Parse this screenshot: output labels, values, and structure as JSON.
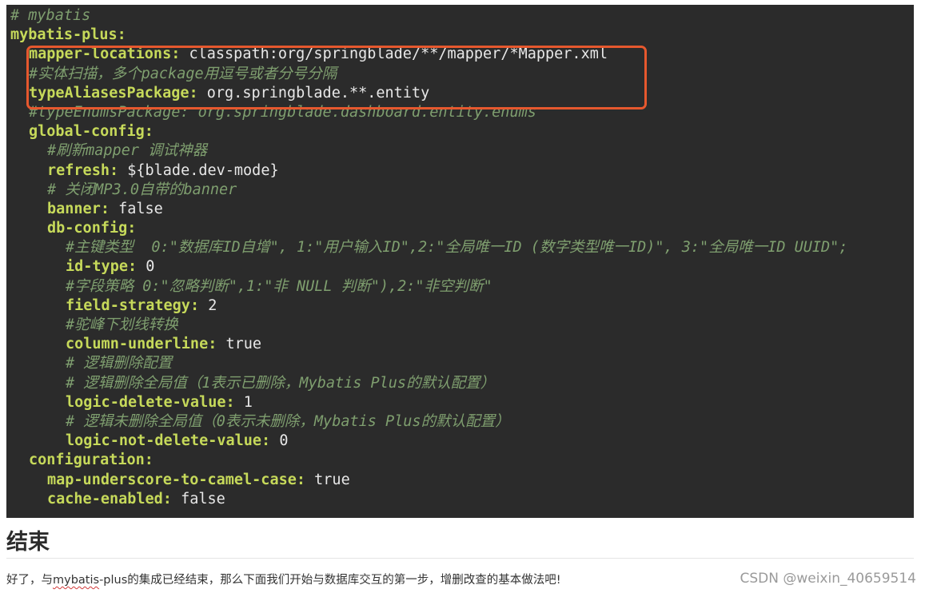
{
  "code": {
    "language": "yaml",
    "highlight_color": "#e6582e",
    "lines": [
      {
        "indent": 0,
        "type": "comment",
        "text": "# mybatis"
      },
      {
        "indent": 0,
        "type": "key",
        "key": "mybatis-plus",
        "value": ""
      },
      {
        "indent": 1,
        "type": "key",
        "key": "mapper-locations",
        "value": "classpath:org/springblade/**/mapper/*Mapper.xml"
      },
      {
        "indent": 1,
        "type": "comment",
        "text": "#实体扫描，多个package用逗号或者分号分隔"
      },
      {
        "indent": 1,
        "type": "key",
        "key": "typeAliasesPackage",
        "value": "org.springblade.**.entity"
      },
      {
        "indent": 1,
        "type": "comment",
        "text": "#typeEnumsPackage: org.springblade.dashboard.entity.enums"
      },
      {
        "indent": 1,
        "type": "key",
        "key": "global-config",
        "value": ""
      },
      {
        "indent": 2,
        "type": "comment",
        "text": "#刷新mapper 调试神器"
      },
      {
        "indent": 2,
        "type": "key",
        "key": "refresh",
        "value": "${blade.dev-mode}"
      },
      {
        "indent": 2,
        "type": "comment",
        "text": "# 关闭MP3.0自带的banner"
      },
      {
        "indent": 2,
        "type": "key",
        "key": "banner",
        "value": "false"
      },
      {
        "indent": 2,
        "type": "key",
        "key": "db-config",
        "value": ""
      },
      {
        "indent": 3,
        "type": "comment",
        "text": "#主键类型  0:\"数据库ID自增\", 1:\"用户输入ID\",2:\"全局唯一ID (数字类型唯一ID)\", 3:\"全局唯一ID UUID\";"
      },
      {
        "indent": 3,
        "type": "key",
        "key": "id-type",
        "value": "0"
      },
      {
        "indent": 3,
        "type": "comment",
        "text": "#字段策略 0:\"忽略判断\",1:\"非 NULL 判断\"),2:\"非空判断\""
      },
      {
        "indent": 3,
        "type": "key",
        "key": "field-strategy",
        "value": "2"
      },
      {
        "indent": 3,
        "type": "comment",
        "text": "#驼峰下划线转换"
      },
      {
        "indent": 3,
        "type": "key",
        "key": "column-underline",
        "value": "true"
      },
      {
        "indent": 3,
        "type": "comment",
        "text": "# 逻辑删除配置"
      },
      {
        "indent": 3,
        "type": "comment",
        "text": "# 逻辑删除全局值（1表示已删除，Mybatis Plus的默认配置）"
      },
      {
        "indent": 3,
        "type": "key",
        "key": "logic-delete-value",
        "value": "1"
      },
      {
        "indent": 3,
        "type": "comment",
        "text": "# 逻辑未删除全局值（0表示未删除，Mybatis Plus的默认配置）"
      },
      {
        "indent": 3,
        "type": "key",
        "key": "logic-not-delete-value",
        "value": "0"
      },
      {
        "indent": 1,
        "type": "key",
        "key": "configuration",
        "value": ""
      },
      {
        "indent": 2,
        "type": "key",
        "key": "map-underscore-to-camel-case",
        "value": "true"
      },
      {
        "indent": 2,
        "type": "key",
        "key": "cache-enabled",
        "value": "false"
      }
    ]
  },
  "article": {
    "heading": "结束",
    "paragraph_before": "好了，与",
    "paragraph_link": "mybatis",
    "paragraph_after": "-plus的集成已经结束，那么下面我们开始与数据库交互的第一步，增删改查的基本做法吧!"
  },
  "watermark": "CSDN @weixin_40659514"
}
